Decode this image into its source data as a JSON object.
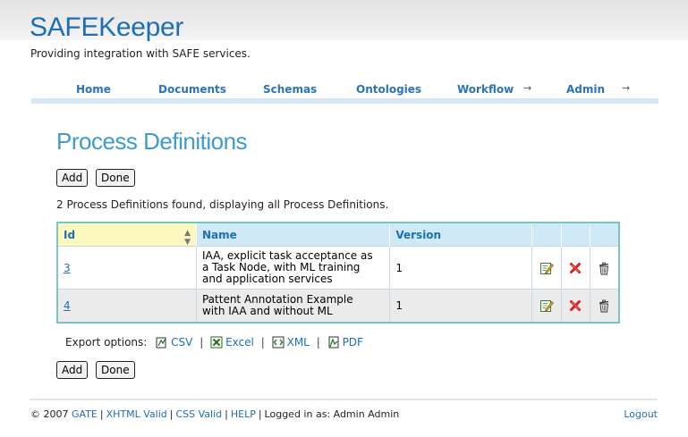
{
  "header": {
    "brand": "SAFEKeeper",
    "tagline": "Providing integration with SAFE services."
  },
  "nav": {
    "items": [
      {
        "label": "Home",
        "has_submenu": false
      },
      {
        "label": "Documents",
        "has_submenu": false
      },
      {
        "label": "Schemas",
        "has_submenu": false
      },
      {
        "label": "Ontologies",
        "has_submenu": false
      },
      {
        "label": "Workflow",
        "has_submenu": true
      },
      {
        "label": "Admin",
        "has_submenu": true
      }
    ],
    "arrow_glyph": "→"
  },
  "page": {
    "title": "Process Definitions",
    "add_label": "Add",
    "done_label": "Done",
    "found_text": "2 Process Definitions found, displaying all Process Definitions."
  },
  "table": {
    "columns": [
      "Id",
      "Name",
      "Version"
    ],
    "sorted_column": "Id",
    "rows": [
      {
        "id": "3",
        "name_lines": [
          "IAA, explicit task acceptance as",
          "a Task Node, with ML training",
          "and application services"
        ],
        "version": "1"
      },
      {
        "id": "4",
        "name_lines": [
          "Pattent Annotation Example",
          "with IAA and without ML"
        ],
        "version": "1"
      }
    ]
  },
  "export": {
    "label": "Export options:",
    "options": [
      "CSV",
      "Excel",
      "XML",
      "PDF"
    ]
  },
  "footer": {
    "copyright": "© 2007",
    "links": [
      "GATE",
      "XHTML Valid",
      "CSS Valid",
      "HELP"
    ],
    "logged_in_text": "Logged in as: Admin Admin",
    "logout_label": "Logout"
  },
  "colors": {
    "brand": "#1d6fb5",
    "title": "#3c9bd1",
    "table_border": "#7dc4c0",
    "header_bg": "#d0e9f6",
    "sorted_header_bg": "#fdf8c0"
  }
}
